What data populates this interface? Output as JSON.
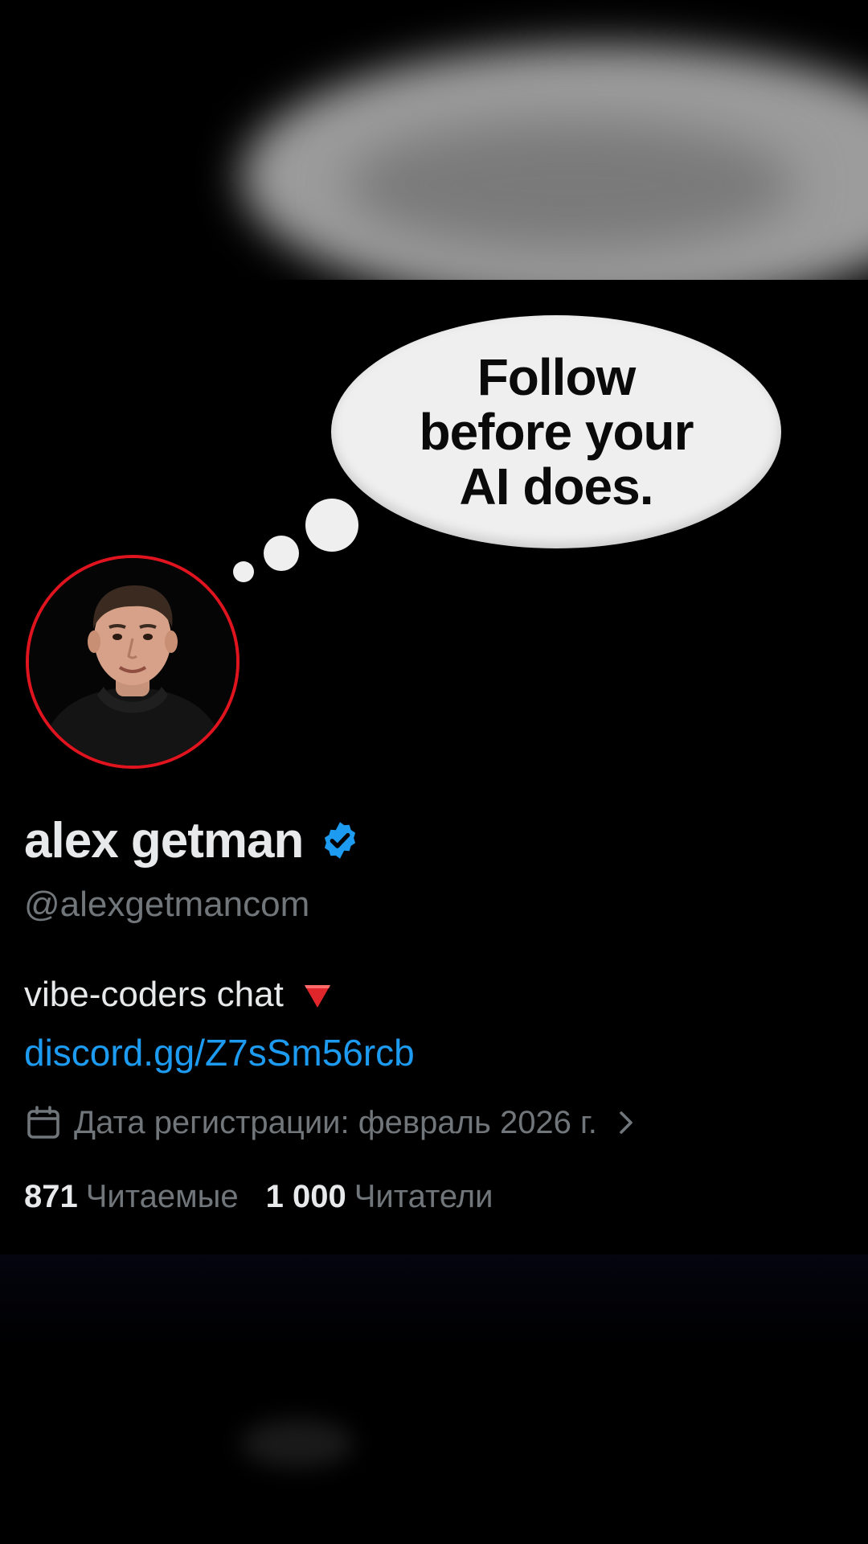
{
  "banner": {
    "bubble_text_line1": "Follow",
    "bubble_text_line2": "before your",
    "bubble_text_line3": "AI does."
  },
  "profile": {
    "display_name": "alex getman",
    "handle": "@alexgetmancom",
    "bio_text": "vibe-coders chat",
    "bio_emoji": "red-triangle-down-icon",
    "link": "discord.gg/Z7sSm56rcb",
    "joined": "Дата регистрации: февраль 2026 г.",
    "following_count": "871",
    "following_label": "Читаемые",
    "followers_count": "1 000",
    "followers_label": "Читатели"
  },
  "colors": {
    "accent": "#1d9bf0",
    "avatar_ring": "#e0141e",
    "muted_text": "#71767b",
    "primary_text": "#e7e9ea"
  }
}
